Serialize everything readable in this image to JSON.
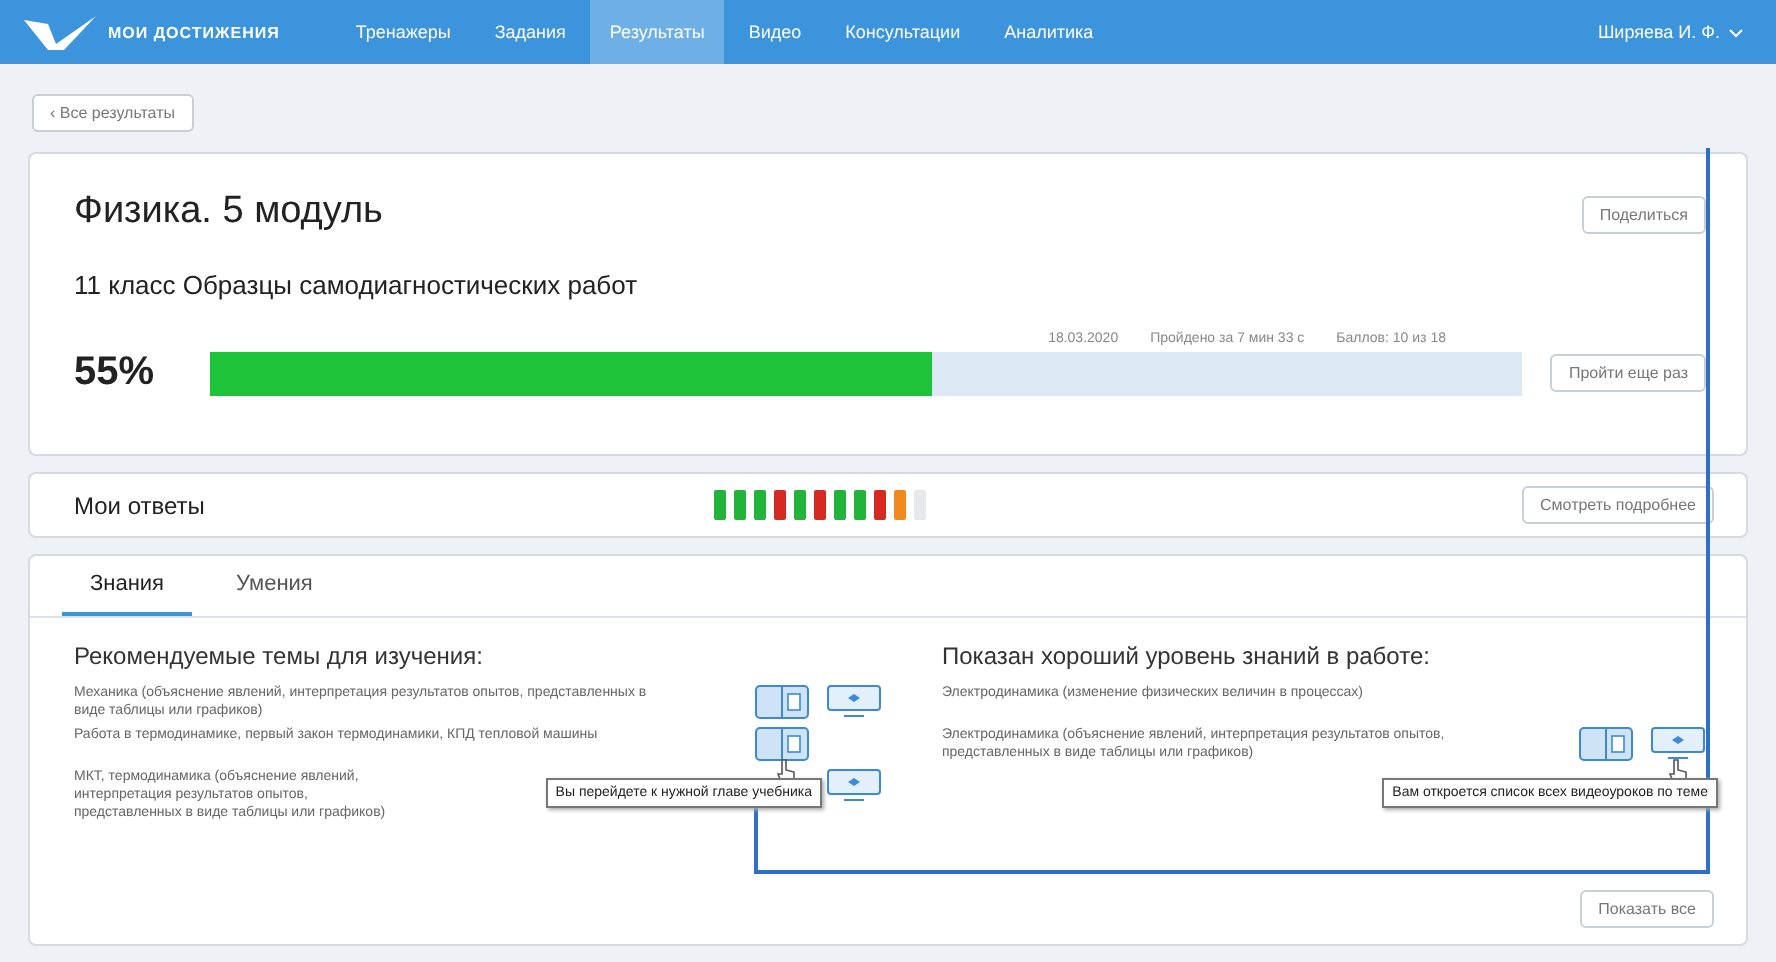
{
  "nav": {
    "logo": "МОИ ДОСТИЖЕНИЯ",
    "items": [
      {
        "label": "Тренажеры",
        "selected": false
      },
      {
        "label": "Задания",
        "selected": false
      },
      {
        "label": "Результаты",
        "selected": true
      },
      {
        "label": "Видео",
        "selected": false
      },
      {
        "label": "Консультации",
        "selected": false
      },
      {
        "label": "Аналитика",
        "selected": false
      }
    ],
    "user": "Ширяева И. Ф."
  },
  "back_button": "‹ Все результаты",
  "result": {
    "title": "Физика. 5 модуль",
    "subtitle": "11 класс Образцы самодиагностических работ",
    "share_button": "Поделиться",
    "date": "18.03.2020",
    "duration": "Пройдено за 7 мин 33 с",
    "score": "Баллов: 10 из 18",
    "percent": "55%",
    "level": 0.55,
    "retry_button": "Пройти еще раз"
  },
  "answers": {
    "title": "Мои ответы",
    "items": [
      {
        "color": "#22b33a"
      },
      {
        "color": "#22b33a"
      },
      {
        "color": "#22b33a"
      },
      {
        "color": "#d42a22"
      },
      {
        "color": "#22b33a"
      },
      {
        "color": "#d42a22"
      },
      {
        "color": "#22b33a"
      },
      {
        "color": "#22b33a"
      },
      {
        "color": "#d42a22"
      },
      {
        "color": "#f08a1c"
      },
      {
        "color": "#e6e8eb"
      }
    ],
    "details_button": "Смотреть подробнее"
  },
  "tabs": [
    {
      "label": "Знания",
      "selected": true
    },
    {
      "label": "Умения",
      "selected": false
    }
  ],
  "columns": [
    {
      "title": "Рекомендуемые темы для изучения:",
      "topics": [
        {
          "text": "Механика (объяснение явлений, интерпретация результатов опытов, представленных в виде таблицы или графиков)",
          "book": true,
          "video": true
        },
        {
          "text": "Работа в термодинамике, первый закон термодинамики, КПД тепловой машины",
          "book": true,
          "video": false,
          "tooltip": "Вы перейдете к нужной главе учебника"
        },
        {
          "text": "МКТ, термодинамика (объяснение явлений, интерпретация результатов опытов, представленных в виде таблицы или графиков)",
          "book": false,
          "video": true
        }
      ]
    },
    {
      "title": "Показан хороший уровень знаний в работе:",
      "topics": [
        {
          "text": "Электродинамика (изменение физических величин в процессах)",
          "book": false,
          "video": false
        },
        {
          "text": "Электродинамика (объяснение явлений, интерпретация результатов опытов, представленных в виде таблицы или графиков)",
          "book": true,
          "video": true,
          "tooltip": "Вам откроется список всех видеоуроков по теме"
        }
      ]
    }
  ],
  "show_all_button": "Показать все"
}
